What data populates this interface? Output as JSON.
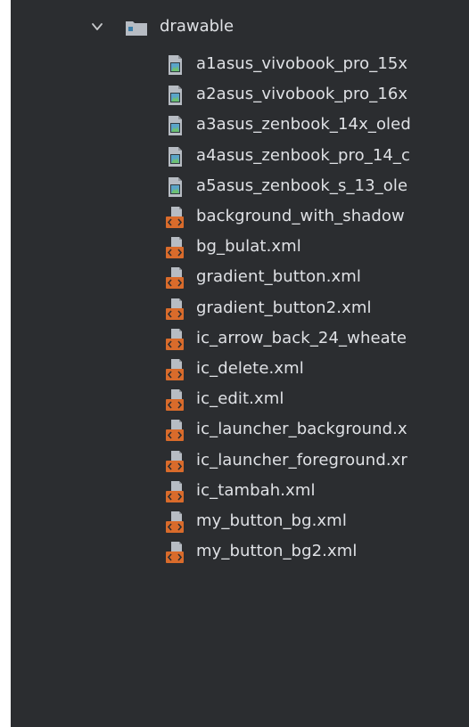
{
  "tree": {
    "folder": {
      "label": "drawable",
      "expanded": true,
      "icon": "folder-icon"
    },
    "files": [
      {
        "label": "a1asus_vivobook_pro_15x",
        "kind": "image"
      },
      {
        "label": "a2asus_vivobook_pro_16x",
        "kind": "image"
      },
      {
        "label": "a3asus_zenbook_14x_oled",
        "kind": "image"
      },
      {
        "label": "a4asus_zenbook_pro_14_c",
        "kind": "image"
      },
      {
        "label": "a5asus_zenbook_s_13_ole",
        "kind": "image"
      },
      {
        "label": "background_with_shadow",
        "kind": "xml"
      },
      {
        "label": "bg_bulat.xml",
        "kind": "xml"
      },
      {
        "label": "gradient_button.xml",
        "kind": "xml"
      },
      {
        "label": "gradient_button2.xml",
        "kind": "xml"
      },
      {
        "label": "ic_arrow_back_24_wheate",
        "kind": "xml"
      },
      {
        "label": "ic_delete.xml",
        "kind": "xml"
      },
      {
        "label": "ic_edit.xml",
        "kind": "xml"
      },
      {
        "label": "ic_launcher_background.x",
        "kind": "xml"
      },
      {
        "label": "ic_launcher_foreground.xr",
        "kind": "xml"
      },
      {
        "label": "ic_tambah.xml",
        "kind": "xml"
      },
      {
        "label": "my_button_bg.xml",
        "kind": "xml"
      },
      {
        "label": "my_button_bg2.xml",
        "kind": "xml"
      }
    ]
  },
  "colors": {
    "background": "#2b2d30",
    "text": "#dfe1e5",
    "xml_icon_accent": "#d96b2b",
    "image_icon_accent": "#5aa4c8"
  }
}
